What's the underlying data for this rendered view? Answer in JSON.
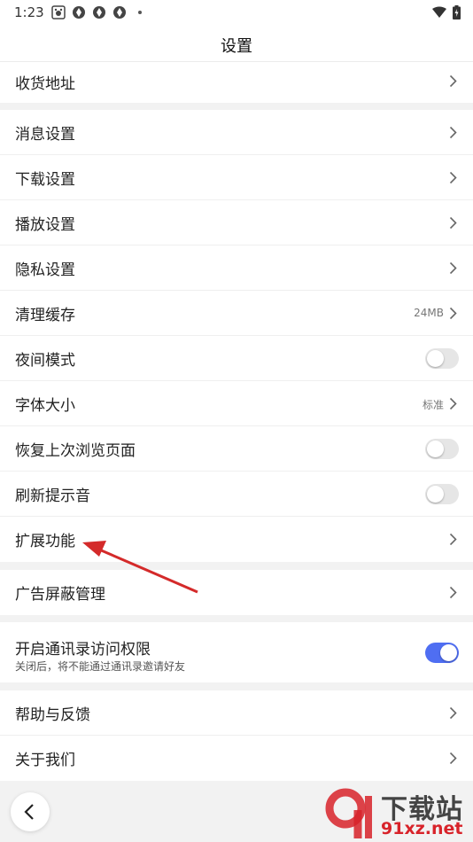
{
  "status_bar": {
    "time": "1:23"
  },
  "header": {
    "title": "设置"
  },
  "group1": [
    {
      "label": "收货地址",
      "type": "chevron"
    }
  ],
  "group2": [
    {
      "label": "消息设置",
      "type": "chevron"
    },
    {
      "label": "下载设置",
      "type": "chevron"
    },
    {
      "label": "播放设置",
      "type": "chevron"
    },
    {
      "label": "隐私设置",
      "type": "chevron"
    },
    {
      "label": "清理缓存",
      "type": "chevron",
      "value": "24MB"
    },
    {
      "label": "夜间模式",
      "type": "toggle",
      "on": false
    },
    {
      "label": "字体大小",
      "type": "chevron",
      "value": "标准"
    },
    {
      "label": "恢复上次浏览页面",
      "type": "toggle",
      "on": false
    },
    {
      "label": "刷新提示音",
      "type": "toggle",
      "on": false
    },
    {
      "label": "扩展功能",
      "type": "chevron"
    }
  ],
  "group3": [
    {
      "label": "广告屏蔽管理",
      "type": "chevron"
    }
  ],
  "group4": {
    "label": "开启通讯录访问权限",
    "subtitle": "关闭后，将不能通过通讯录邀请好友",
    "on": true
  },
  "group5": [
    {
      "label": "帮助与反馈",
      "type": "chevron"
    },
    {
      "label": "关于我们",
      "type": "chevron"
    }
  ],
  "watermark": {
    "text1": "下载站",
    "text2": "91xz.net"
  },
  "colors": {
    "toggle_on": "#4f6ef2",
    "arrow": "#d42a2a"
  }
}
